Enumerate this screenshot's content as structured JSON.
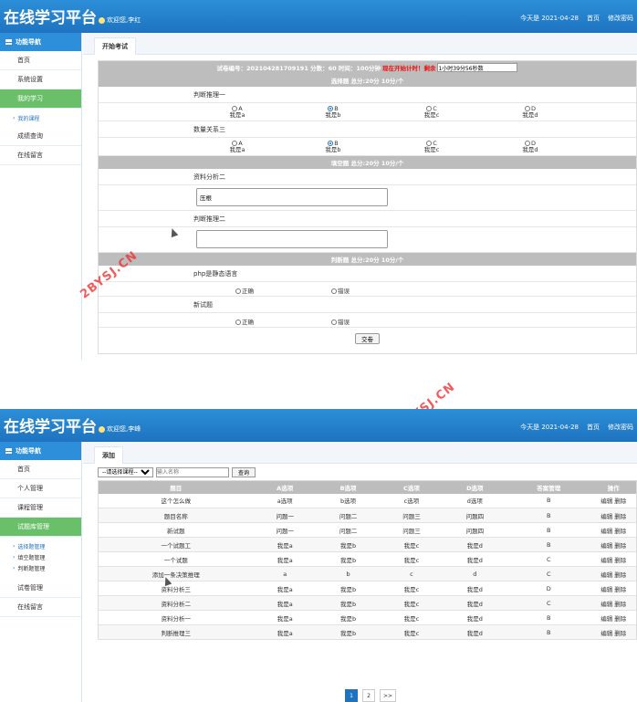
{
  "shot1": {
    "header": {
      "title": "在线学习平台",
      "welcome": "欢迎您,李红",
      "date": "今天是 2021-04-28",
      "home": "首页",
      "change_pwd": "修改密码"
    },
    "nav": {
      "head": "功能导航",
      "items": [
        "首页",
        "系统设置",
        "我的学习"
      ],
      "sub": [
        "我的课程"
      ],
      "items2": [
        "成绩查询",
        "在线留言"
      ]
    },
    "tab": "开始考试",
    "exam": {
      "info": "试卷编号：202104281709191 分数：60 时间：100分钟",
      "start_text": "现在开始计时！剩余",
      "timer": "1小时39分56秒数"
    },
    "sections": {
      "choice": "选择题 总分:20分 10分/个",
      "fill": "填空题 总分:20分 10分/个",
      "judge": "判断题 总分:20分 10分/个"
    },
    "choice_questions": [
      {
        "title": "判断推理一",
        "options": [
          {
            "letter": "A",
            "text": "我是a"
          },
          {
            "letter": "B",
            "text": "我是b"
          },
          {
            "letter": "C",
            "text": "我是c"
          },
          {
            "letter": "D",
            "text": "我是d"
          }
        ]
      },
      {
        "title": "数量关系三",
        "options": [
          {
            "letter": "A",
            "text": "我是a"
          },
          {
            "letter": "B",
            "text": "我是b"
          },
          {
            "letter": "C",
            "text": "我是c"
          },
          {
            "letter": "D",
            "text": "我是d"
          }
        ]
      }
    ],
    "fill_questions": [
      {
        "title": "资料分析二",
        "value": "压根"
      },
      {
        "title": "判断推理二",
        "value": ""
      }
    ],
    "judge_questions": [
      {
        "title": "php是静态语言",
        "true_label": "正确",
        "false_label": "错误"
      },
      {
        "title": "新试题",
        "true_label": "正确",
        "false_label": "错误"
      }
    ],
    "submit": "交卷"
  },
  "shot2": {
    "header": {
      "title": "在线学习平台",
      "welcome": "欢迎您,李峰",
      "date": "今天是 2021-04-28",
      "home": "首页",
      "change_pwd": "修改密码"
    },
    "nav": {
      "head": "功能导航",
      "items": [
        "首页",
        "个人管理",
        "课程管理",
        "试题库管理"
      ],
      "sub": [
        "选择题管理",
        "填空题管理",
        "判断题管理"
      ],
      "items2": [
        "试卷管理",
        "在线留言"
      ]
    },
    "tab": "添加",
    "filters": {
      "select": "--请选择课程--",
      "placeholder": "输入名称",
      "search": "查询"
    },
    "table": {
      "headers": [
        "题目",
        "A选项",
        "B选项",
        "C选项",
        "D选项",
        "答案管理",
        "操作"
      ],
      "rows": [
        [
          "这个怎么做",
          "a选项",
          "b选项",
          "c选项",
          "d选项",
          "B"
        ],
        [
          "题目名称",
          "问题一",
          "问题二",
          "问题三",
          "问题四",
          "B"
        ],
        [
          "新试题",
          "问题一",
          "问题二",
          "问题三",
          "问题四",
          "B"
        ],
        [
          "一个试题工",
          "我是a",
          "我是b",
          "我是c",
          "我是d",
          "B"
        ],
        [
          "一个试题",
          "我是a",
          "我是b",
          "我是c",
          "我是d",
          "C"
        ],
        [
          "添加一条决策推理",
          "a",
          "b",
          "c",
          "d",
          "C"
        ],
        [
          "资料分析三",
          "我是a",
          "我是b",
          "我是c",
          "我是d",
          "D"
        ],
        [
          "资料分析二",
          "我是a",
          "我是b",
          "我是c",
          "我是d",
          "C"
        ],
        [
          "资料分析一",
          "我是a",
          "我是b",
          "我是c",
          "我是d",
          "B"
        ],
        [
          "判断推理三",
          "我是a",
          "我是b",
          "我是c",
          "我是d",
          "B"
        ]
      ],
      "edit": "编辑",
      "delete": "删除"
    },
    "pager": [
      "1",
      "2",
      ">>"
    ]
  },
  "watermark": "2BYSJ.CN"
}
